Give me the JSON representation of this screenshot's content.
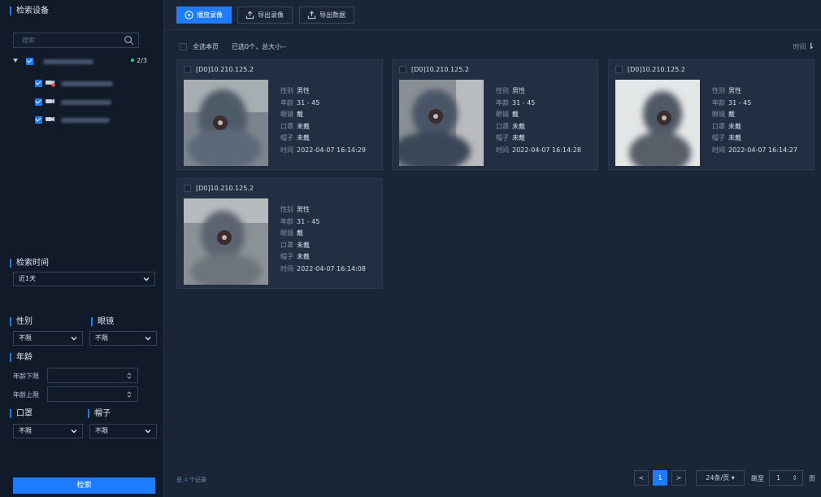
{
  "sidebar": {
    "device_title": "检索设备",
    "search_placeholder": "搜索",
    "tree_count": "2/3",
    "time_title": "检索时间",
    "time_value": "近1天",
    "gender_title": "性别",
    "gender_value": "不限",
    "glasses_title": "眼镜",
    "glasses_value": "不限",
    "age_title": "年龄",
    "age_min_label": "年龄下限",
    "age_max_label": "年龄上限",
    "mask_title": "口罩",
    "mask_value": "不限",
    "hat_title": "帽子",
    "hat_value": "不限",
    "search_button": "检索"
  },
  "toolbar": {
    "play": "播放录像",
    "export_video": "导出录像",
    "export_data": "导出数据"
  },
  "selection": {
    "select_all": "全选本页",
    "selected_info": "已选0个，总大小--",
    "sort_label": "时间"
  },
  "labels": {
    "gender": "性别",
    "age": "年龄",
    "glasses": "眼镜",
    "mask": "口罩",
    "hat": "帽子",
    "time": "时间"
  },
  "records": [
    {
      "channel": "[D0]10.210.125.2",
      "gender": "男性",
      "age": "31 - 45",
      "glasses": "戴",
      "mask": "未戴",
      "hat": "未戴",
      "time": "2022-04-07 16:14:29"
    },
    {
      "channel": "[D0]10.210.125.2",
      "gender": "男性",
      "age": "31 - 45",
      "glasses": "戴",
      "mask": "未戴",
      "hat": "未戴",
      "time": "2022-04-07 16:14:28"
    },
    {
      "channel": "[D0]10.210.125.2",
      "gender": "男性",
      "age": "31 - 45",
      "glasses": "戴",
      "mask": "未戴",
      "hat": "未戴",
      "time": "2022-04-07 16:14:27"
    },
    {
      "channel": "[D0]10.210.125.2",
      "gender": "男性",
      "age": "31 - 45",
      "glasses": "戴",
      "mask": "未戴",
      "hat": "未戴",
      "time": "2022-04-07 16:14:08"
    }
  ],
  "footer": {
    "total_prefix": "总",
    "total_count": "4",
    "total_suffix": "个记录",
    "prev": "<",
    "current_page": "1",
    "next": ">",
    "page_size": "24条/页",
    "jump_label": "跳至",
    "jump_value": "1",
    "page_unit": "页"
  },
  "colors": {
    "accent": "#1f7cff",
    "online": "#2fd07a"
  }
}
